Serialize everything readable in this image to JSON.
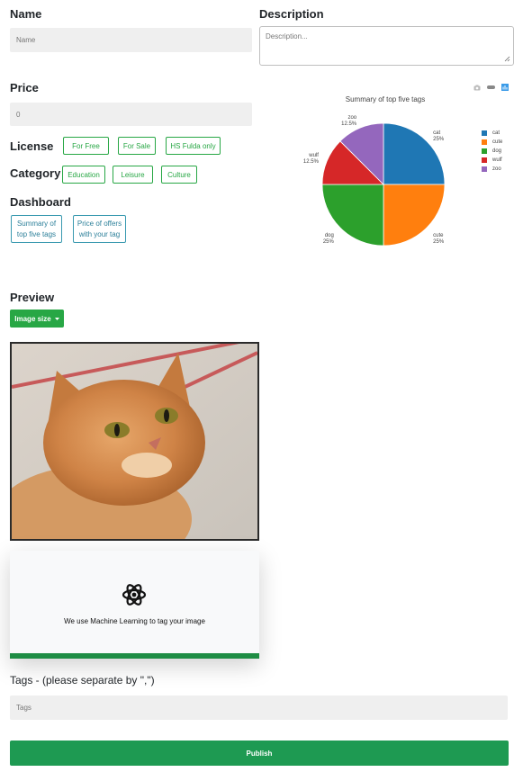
{
  "form": {
    "name_label": "Name",
    "name_placeholder": "Name",
    "description_label": "Description",
    "description_placeholder": "Description...",
    "price_label": "Price",
    "price_value": "0",
    "license_label": "License",
    "license_options": [
      "For Free",
      "For Sale",
      "HS Fulda only"
    ],
    "category_label": "Category",
    "category_options": [
      "Education",
      "Leisure",
      "Culture"
    ],
    "dashboard_label": "Dashboard",
    "dashboard_buttons": [
      "Summary of top five tags",
      "Price of offers with your tag"
    ],
    "preview_label": "Preview",
    "image_size_label": "Image size",
    "ml_message": "We use Machine Learning to tag your image",
    "ml_progress": 1.0,
    "tags_label": "Tags - (please separate by \",\")",
    "tags_placeholder": "Tags",
    "publish_label": "Publish"
  },
  "chart_toolbar": {
    "icons": [
      "camera-icon",
      "zoom-icon",
      "plotly-logo-icon"
    ]
  },
  "chart_data": {
    "type": "pie",
    "title": "Summary of top five tags",
    "legend_position": "right",
    "slices": [
      {
        "label": "cat",
        "value": 25,
        "percent": "25%",
        "color": "#1f77b4"
      },
      {
        "label": "cute",
        "value": 25,
        "percent": "25%",
        "color": "#ff7f0e"
      },
      {
        "label": "dog",
        "value": 25,
        "percent": "25%",
        "color": "#2ca02c"
      },
      {
        "label": "wulf",
        "value": 12.5,
        "percent": "12.5%",
        "color": "#d62728"
      },
      {
        "label": "zoo",
        "value": 12.5,
        "percent": "12.5%",
        "color": "#9467bd"
      }
    ]
  }
}
